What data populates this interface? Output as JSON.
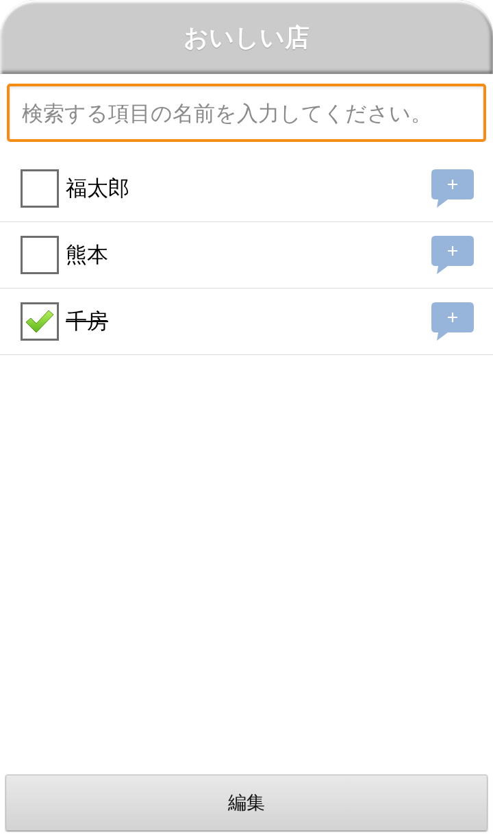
{
  "header": {
    "title": "おいしい店"
  },
  "search": {
    "placeholder": "検索する項目の名前を入力してください。"
  },
  "items": [
    {
      "name": "福太郎",
      "checked": false
    },
    {
      "name": "熊本",
      "checked": false
    },
    {
      "name": "千房",
      "checked": true
    }
  ],
  "edit_button": {
    "label": "編集"
  }
}
